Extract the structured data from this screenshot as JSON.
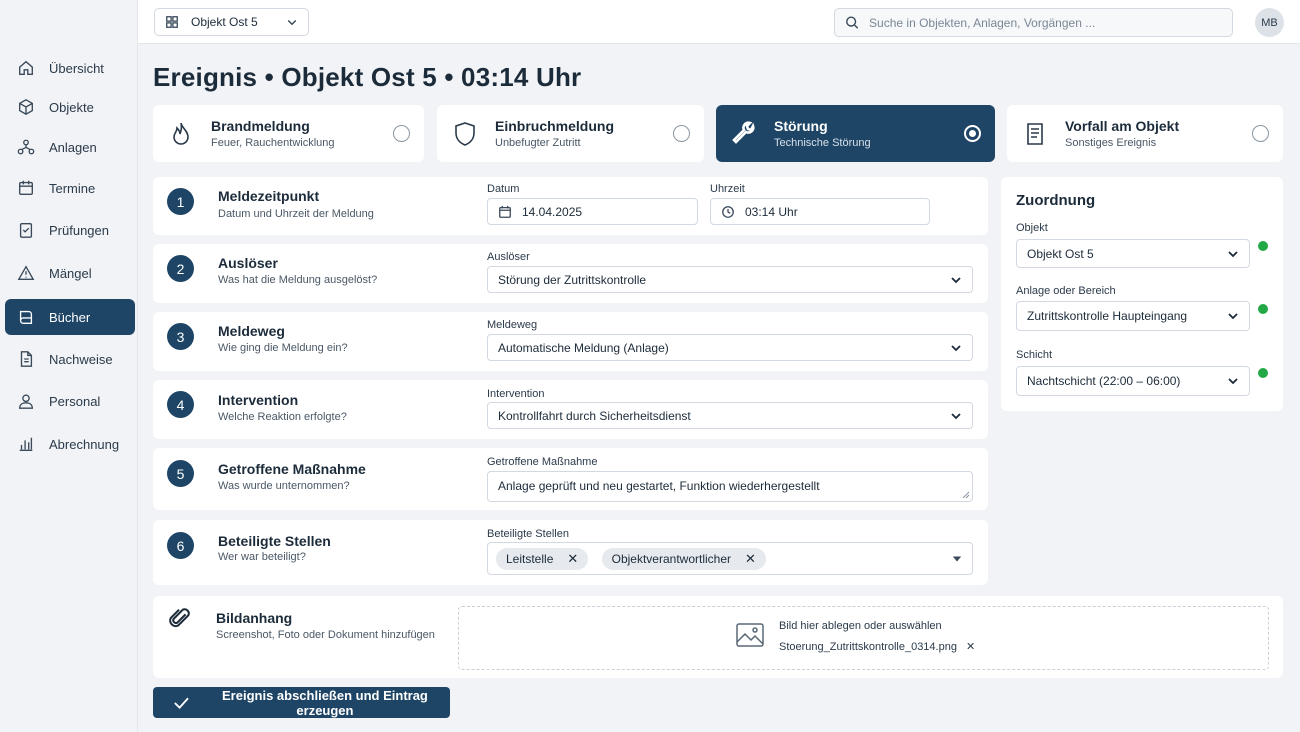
{
  "sidebar": {
    "items": [
      {
        "label": "Übersicht",
        "icon": "home-icon"
      },
      {
        "label": "Objekte",
        "icon": "cube-icon"
      },
      {
        "label": "Anlagen",
        "icon": "network-icon"
      },
      {
        "label": "Termine",
        "icon": "calendar-icon"
      },
      {
        "label": "Prüfungen",
        "icon": "checklist-icon"
      },
      {
        "label": "Mängel",
        "icon": "warning-icon"
      },
      {
        "label": "Bücher",
        "icon": "book-icon",
        "active": true
      },
      {
        "label": "Nachweise",
        "icon": "document-icon"
      },
      {
        "label": "Personal",
        "icon": "person-icon"
      },
      {
        "label": "Abrechnung",
        "icon": "bar-chart-icon"
      }
    ]
  },
  "topbar": {
    "object_select": "Objekt Ost 5",
    "search_placeholder": "Suche in Objekten, Anlagen, Vorgängen ...",
    "avatar_initials": "MB"
  },
  "page_title": "Ereignis • Objekt Ost 5 • 03:14 Uhr",
  "event_types": [
    {
      "title": "Brandmeldung",
      "subtitle": "Feuer, Rauchentwicklung",
      "icon": "flame-icon",
      "selected": false
    },
    {
      "title": "Einbruchmeldung",
      "subtitle": "Unbefugter Zutritt",
      "icon": "shield-icon",
      "selected": false
    },
    {
      "title": "Störung",
      "subtitle": "Technische Störung",
      "icon": "wrench-icon",
      "selected": true
    },
    {
      "title": "Vorfall am Objekt",
      "subtitle": "Sonstiges Ereignis",
      "icon": "document-icon",
      "selected": false
    }
  ],
  "steps": [
    {
      "num": "1",
      "title": "Meldezeitpunkt",
      "subtitle": "Datum und Uhrzeit der Meldung",
      "date_label": "Datum",
      "date_value": "14.04.2025",
      "time_label": "Uhrzeit",
      "time_value": "03:14 Uhr"
    },
    {
      "num": "2",
      "title": "Auslöser",
      "subtitle": "Was hat die Meldung ausgelöst?",
      "field_label": "Auslöser",
      "value": "Störung der Zutrittskontrolle"
    },
    {
      "num": "3",
      "title": "Meldeweg",
      "subtitle": "Wie ging die Meldung ein?",
      "field_label": "Meldeweg",
      "value": "Automatische Meldung (Anlage)"
    },
    {
      "num": "4",
      "title": "Intervention",
      "subtitle": "Welche Reaktion erfolgte?",
      "field_label": "Intervention",
      "value": "Kontrollfahrt durch Sicherheitsdienst"
    },
    {
      "num": "5",
      "title": "Getroffene Maßnahme",
      "subtitle": "Was wurde unternommen?",
      "field_label": "Getroffene Maßnahme",
      "value": "Anlage geprüft und neu gestartet, Funktion wiederhergestellt"
    },
    {
      "num": "6",
      "title": "Beteiligte Stellen",
      "subtitle": "Wer war beteiligt?",
      "field_label": "Beteiligte Stellen",
      "chips": [
        "Leitstelle",
        "Objektverantwortlicher"
      ]
    }
  ],
  "attachment": {
    "title": "Bildanhang",
    "subtitle": "Screenshot, Foto oder Dokument hinzufügen",
    "drop_text": "Bild hier ablegen oder auswählen",
    "file_name": "Stoerung_Zutrittskontrolle_0314.png"
  },
  "assignment": {
    "title": "Zuordnung",
    "fields": [
      {
        "label": "Objekt",
        "value": "Objekt Ost 5"
      },
      {
        "label": "Anlage oder Bereich",
        "value": "Zutrittskontrolle Haupteingang"
      },
      {
        "label": "Schicht",
        "value": "Nachtschicht (22:00 – 06:00)"
      }
    ],
    "status_color": "#22a844"
  },
  "submit_label": "Ereignis abschließen und Eintrag erzeugen",
  "colors": {
    "accent": "#1f4566",
    "ok": "#22a844"
  }
}
